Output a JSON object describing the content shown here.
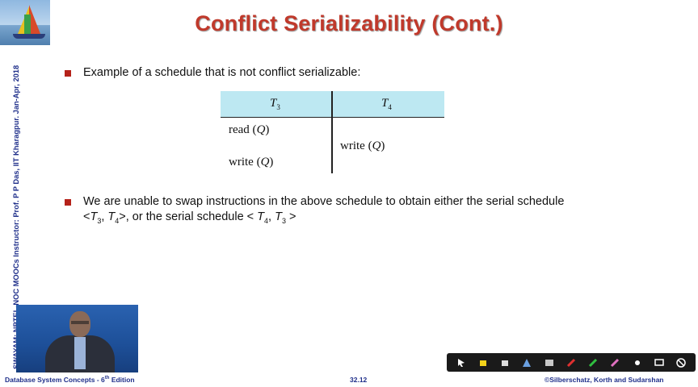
{
  "slide": {
    "title": "Conflict Serializability (Cont.)",
    "side_text": "SWAYAM: NPTEL-NOC MOOCs Instructor: Prof. P P Das, IIT Kharagpur. Jan-Apr, 2018",
    "bullet1": "Example of a schedule that is not conflict serializable:",
    "bullet2_line1": "We are unable to swap instructions in the above schedule to obtain either the serial schedule",
    "bullet2_line2": {
      "part1": "<",
      "t3": "T",
      "t3_sub": "3",
      "sep": ", ",
      "t4": "T",
      "t4_sub": "4",
      "part2": ">, or the serial schedule < ",
      "t4b": "T",
      "t4b_sub": "4",
      "sep2": ", ",
      "t3b": "T",
      "t3b_sub": "3",
      "part3": " >"
    }
  },
  "schedule": {
    "col1_header": "T",
    "col1_sub": "3",
    "col2_header": "T",
    "col2_sub": "4",
    "t3_op1_pre": "read (",
    "t3_op1_var": "Q",
    "t3_op1_post": ")",
    "t3_op2_pre": "write (",
    "t3_op2_var": "Q",
    "t3_op2_post": ")",
    "t4_op1_pre": "write (",
    "t4_op1_var": "Q",
    "t4_op1_post": ")"
  },
  "footer": {
    "left": "Database System Concepts - 6",
    "left_sup": "th",
    "left_end": " Edition",
    "center": "32.12",
    "right": "©Silberschatz, Korth and Sudarshan"
  },
  "colors": {
    "title": "#c0392b",
    "bullet": "#b5221a",
    "table_header": "#bde8f2",
    "footer_text": "#1f2f8a"
  },
  "toolbar_icons": [
    "pointer-icon",
    "highlighter-icon",
    "eraser-icon",
    "shape-icon",
    "text-icon",
    "pen-red-icon",
    "pen-green-icon",
    "marker-icon",
    "laser-icon",
    "screen-icon",
    "stop-icon"
  ]
}
